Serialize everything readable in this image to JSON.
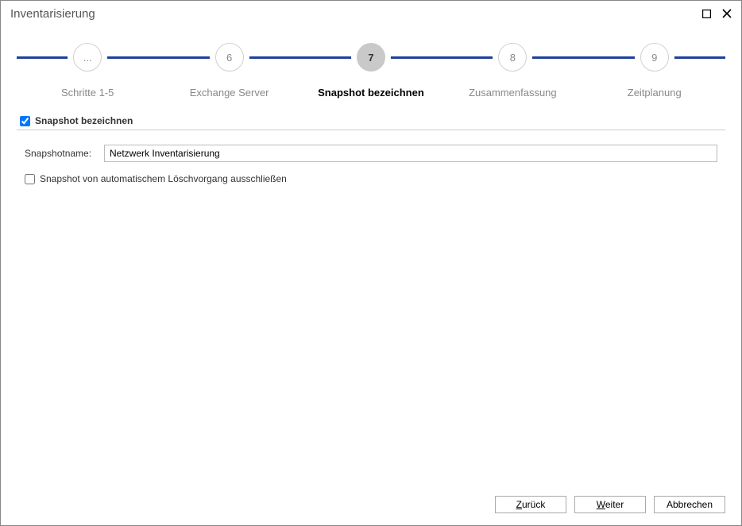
{
  "window": {
    "title": "Inventarisierung"
  },
  "stepper": {
    "steps": [
      {
        "num": "...",
        "label": "Schritte 1-5",
        "active": false
      },
      {
        "num": "6",
        "label": "Exchange Server",
        "active": false
      },
      {
        "num": "7",
        "label": "Snapshot bezeichnen",
        "active": true
      },
      {
        "num": "8",
        "label": "Zusammenfassung",
        "active": false
      },
      {
        "num": "9",
        "label": "Zeitplanung",
        "active": false
      }
    ]
  },
  "section": {
    "checkbox_checked": true,
    "title": "Snapshot bezeichnen"
  },
  "form": {
    "snapshot_name_label": "Snapshotname:",
    "snapshot_name_value": "Netzwerk Inventarisierung",
    "exclude_checked": false,
    "exclude_label": "Snapshot von automatischem Löschvorgang ausschließen"
  },
  "buttons": {
    "back_prefix": "Z",
    "back_rest": "urück",
    "next_prefix": "W",
    "next_rest": "eiter",
    "cancel": "Abbrechen"
  }
}
